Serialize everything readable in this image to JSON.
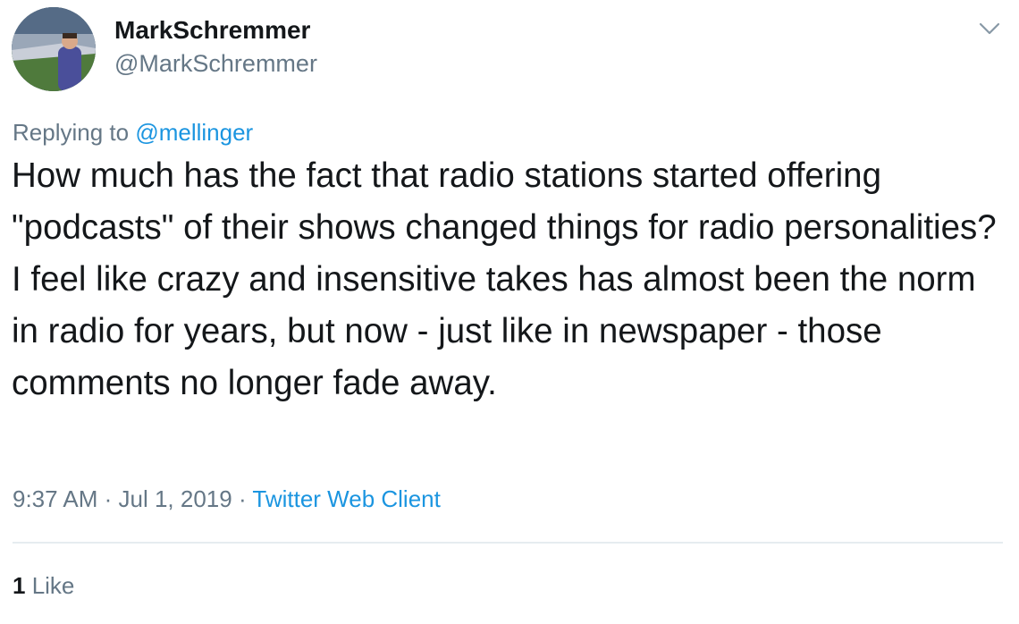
{
  "user": {
    "display_name": "MarkSchremmer",
    "handle": "@MarkSchremmer"
  },
  "reply": {
    "prefix": "Replying to ",
    "mention": "@mellinger"
  },
  "tweet": {
    "text": "How much has the fact that radio stations started offering \"podcasts\" of their shows changed things for radio personalities? I feel like crazy and insensitive takes has almost been the norm in radio for years, but now - just like in newspaper - those comments no longer fade away."
  },
  "meta": {
    "time": "9:37 AM",
    "sep1": " · ",
    "date": "Jul 1, 2019",
    "sep2": " · ",
    "client": "Twitter Web Client"
  },
  "stats": {
    "like_count": "1",
    "like_label": " Like"
  },
  "icons": {
    "menu": "chevron-down-icon"
  },
  "colors": {
    "link": "#1b95e0",
    "secondary": "#657786",
    "primary": "#14171a"
  }
}
